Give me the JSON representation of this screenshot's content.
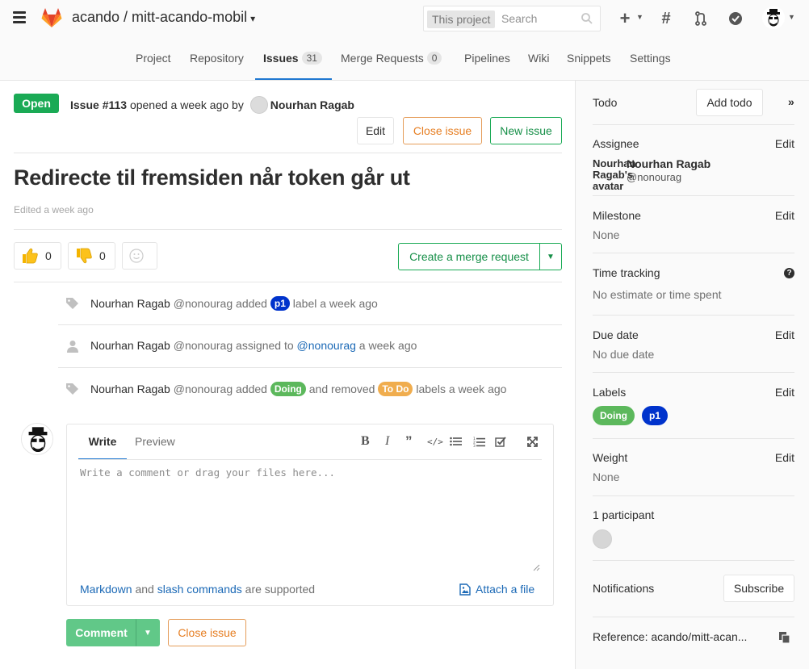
{
  "navbar": {
    "project_path": "acando / mitt-acando-mobil",
    "search_scope": "This project",
    "search_placeholder": "Search",
    "icons": [
      "menu-icon",
      "gitlab-logo",
      "search-icon",
      "plus-icon",
      "hash-icon",
      "merge-request-icon",
      "todo-icon",
      "user-avatar"
    ]
  },
  "subnav": {
    "items": [
      {
        "label": "Project"
      },
      {
        "label": "Repository"
      },
      {
        "label": "Issues",
        "count": "31",
        "active": true
      },
      {
        "label": "Merge Requests",
        "count": "0"
      },
      {
        "label": "Pipelines"
      },
      {
        "label": "Wiki"
      },
      {
        "label": "Snippets"
      },
      {
        "label": "Settings"
      }
    ]
  },
  "issue": {
    "status": "Open",
    "number": "Issue #113",
    "opened_text": " opened a week ago by ",
    "author": "Nourhan Ragab",
    "edit_label": "Edit",
    "close_label": "Close issue",
    "new_label": "New issue",
    "title": "Redirecte til fremsiden når token går ut",
    "edited": "Edited a week ago",
    "thumbs_up": "0",
    "thumbs_down": "0",
    "create_mr_label": "Create a merge request"
  },
  "events": [
    {
      "author": "Nourhan Ragab",
      "username": "@nonourag",
      "text_before": " added ",
      "label": "p1",
      "text_after": " label a week ago"
    },
    {
      "author": "Nourhan Ragab",
      "username": "@nonourag",
      "text_before": " assigned to ",
      "mention": "@nonourag",
      "text_after": " a week ago"
    },
    {
      "author": "Nourhan Ragab",
      "username": "@nonourag",
      "text_before": " added ",
      "label": "Doing",
      "middle": " and removed ",
      "label2": "To Do",
      "text_after": " labels a week ago"
    }
  ],
  "comment_form": {
    "write_tab": "Write",
    "preview_tab": "Preview",
    "placeholder": "Write a comment or drag your files here...",
    "markdown_link": "Markdown",
    "and_text": " and ",
    "slash_link": "slash commands",
    "supported_text": " are supported",
    "attach_label": "Attach a file",
    "comment_button": "Comment",
    "close_button": "Close issue"
  },
  "sidebar": {
    "todo_label": "Todo",
    "add_todo": "Add todo",
    "assignee_label": "Assignee",
    "edit": "Edit",
    "assignee_avatar_alt": "Nourhan Ragab's avatar",
    "assignee_name": "Nourhan Ragab",
    "assignee_username": "@nonourag",
    "milestone_label": "Milestone",
    "milestone_value": "None",
    "time_tracking_label": "Time tracking",
    "time_tracking_value": "No estimate or time spent",
    "due_date_label": "Due date",
    "due_date_value": "No due date",
    "labels_label": "Labels",
    "labels": [
      {
        "name": "Doing",
        "color": "#5cb85c"
      },
      {
        "name": "p1",
        "color": "#0033cc"
      }
    ],
    "weight_label": "Weight",
    "weight_value": "None",
    "participants_label": "1 participant",
    "notifications_label": "Notifications",
    "subscribe_label": "Subscribe",
    "reference": "Reference: acando/mitt-acan..."
  },
  "colors": {
    "open": "#1aaa55",
    "close_orange": "#e67e22",
    "green": "#168f48",
    "label_p1": "#0033cc",
    "label_doing": "#5cb85c",
    "label_todo": "#f0ad4e",
    "link": "#1b69b6"
  }
}
